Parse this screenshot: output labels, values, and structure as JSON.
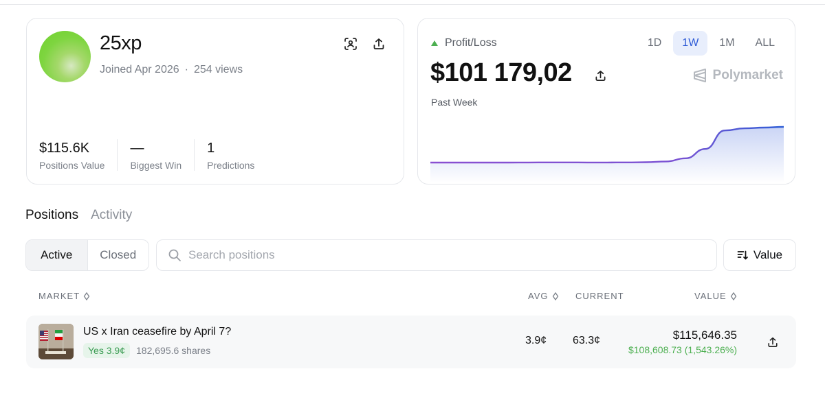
{
  "profile": {
    "username": "25xp",
    "joined": "Joined Apr 2026",
    "separator": "·",
    "views": "254 views",
    "stats": [
      {
        "value": "$115.6K",
        "label": "Positions Value"
      },
      {
        "value": "—",
        "label": "Biggest Win"
      },
      {
        "value": "1",
        "label": "Predictions"
      }
    ]
  },
  "pnl": {
    "label": "Profit/Loss",
    "value": "$101 179,02",
    "period": "Past Week",
    "brand": "Polymarket",
    "ranges": [
      "1D",
      "1W",
      "1M",
      "ALL"
    ],
    "active_range": "1W",
    "colors": {
      "up": "#4caf50",
      "line_start": "#8a4fd1",
      "line_end": "#2f5fd6",
      "active_range_bg": "#e8eefc"
    }
  },
  "chart_data": {
    "type": "area",
    "title": "",
    "xlabel": "",
    "ylabel": "",
    "series": [
      {
        "values": [
          0.0,
          0.0,
          0.0,
          0.0,
          0.0,
          0.002,
          0.004,
          0.003,
          0.001,
          0.002,
          0.003,
          0.01,
          0.03,
          0.12,
          0.38,
          0.9,
          0.96,
          0.98,
          1.0
        ]
      }
    ],
    "ylim": [
      0,
      1
    ],
    "grid": false,
    "legend": "none"
  },
  "tabs": {
    "positions": "Positions",
    "activity": "Activity",
    "active": "Positions"
  },
  "filter": {
    "active": "Active",
    "closed": "Closed"
  },
  "search": {
    "placeholder": "Search positions"
  },
  "sort": {
    "label": "Value"
  },
  "table": {
    "headers": {
      "market": "MARKET",
      "avg": "AVG",
      "current": "CURRENT",
      "value": "VALUE"
    },
    "rows": [
      {
        "title": "US x Iran ceasefire by April 7?",
        "outcome": "Yes 3.9¢",
        "shares": "182,695.6 shares",
        "avg": "3.9¢",
        "current": "63.3¢",
        "value": "$115,646.35",
        "pnl": "$108,608.73 (1,543.26%)"
      }
    ]
  }
}
